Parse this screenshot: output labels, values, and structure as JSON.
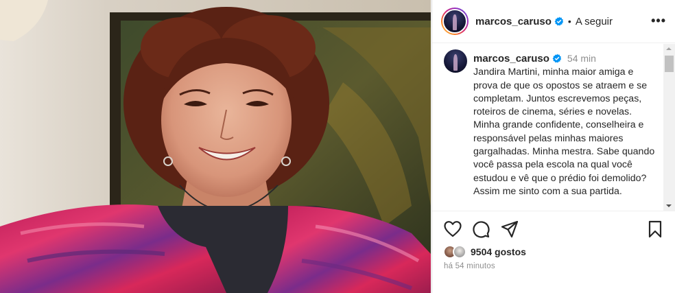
{
  "post": {
    "username": "marcos_caruso",
    "follow_label": "A seguir",
    "separator": "•",
    "more_label": "•••",
    "caption_time": "54 min",
    "caption": "Jandira Martini, minha maior amiga e prova de que os opostos se atraem e se completam. Juntos escrevemos peças, roteiros de cinema, séries e novelas. Minha grande confidente, conselheira e responsável pelas minhas maiores gargalhadas. Minha mestra. Sabe quando você passa pela escola na qual você estudou e vê que o prédio foi demolido? Assim me sinto com a sua partida.",
    "likes": "9504 gostos",
    "timestamp": "há 54 minutos"
  },
  "icons": {
    "like": "heart-icon",
    "comment": "comment-icon",
    "share": "paper-plane-icon",
    "save": "bookmark-icon",
    "verified": "verified-badge-icon",
    "more": "more-options-icon"
  },
  "colors": {
    "verified_blue": "#0095f6",
    "text": "#262626",
    "secondary_text": "#8e8e8e",
    "border": "#dbdbdb"
  }
}
